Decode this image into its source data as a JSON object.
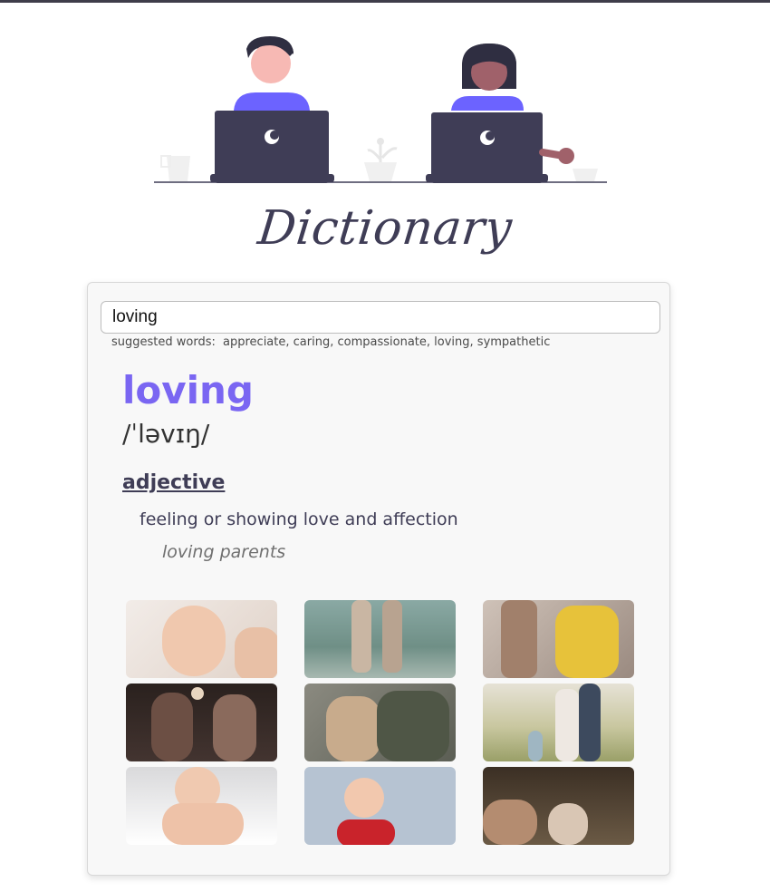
{
  "header": {
    "title": "Dictionary"
  },
  "search": {
    "value": "loving"
  },
  "suggestions": {
    "prefix": "suggested words:",
    "words": [
      "appreciate,",
      "caring,",
      "compassionate,",
      "loving,",
      "sympathetic"
    ]
  },
  "entry": {
    "word": "loving",
    "phonetic": "/ˈləvɪŋ/",
    "part_of_speech": "adjective",
    "definition": "feeling or showing love and affection",
    "example": "loving parents"
  },
  "images": [
    {
      "name": "photo-baby-laughing"
    },
    {
      "name": "photo-couple-beach"
    },
    {
      "name": "photo-child-yellow-jacket"
    },
    {
      "name": "photo-couple-laughing"
    },
    {
      "name": "photo-father-child-hug"
    },
    {
      "name": "photo-family-park"
    },
    {
      "name": "photo-baby-crawling"
    },
    {
      "name": "photo-toddler-red-shirt"
    },
    {
      "name": "photo-father-child-ground"
    }
  ],
  "colors": {
    "accent": "#7a66f2",
    "ink": "#3f3d56",
    "card_bg": "#f8f8f8"
  }
}
